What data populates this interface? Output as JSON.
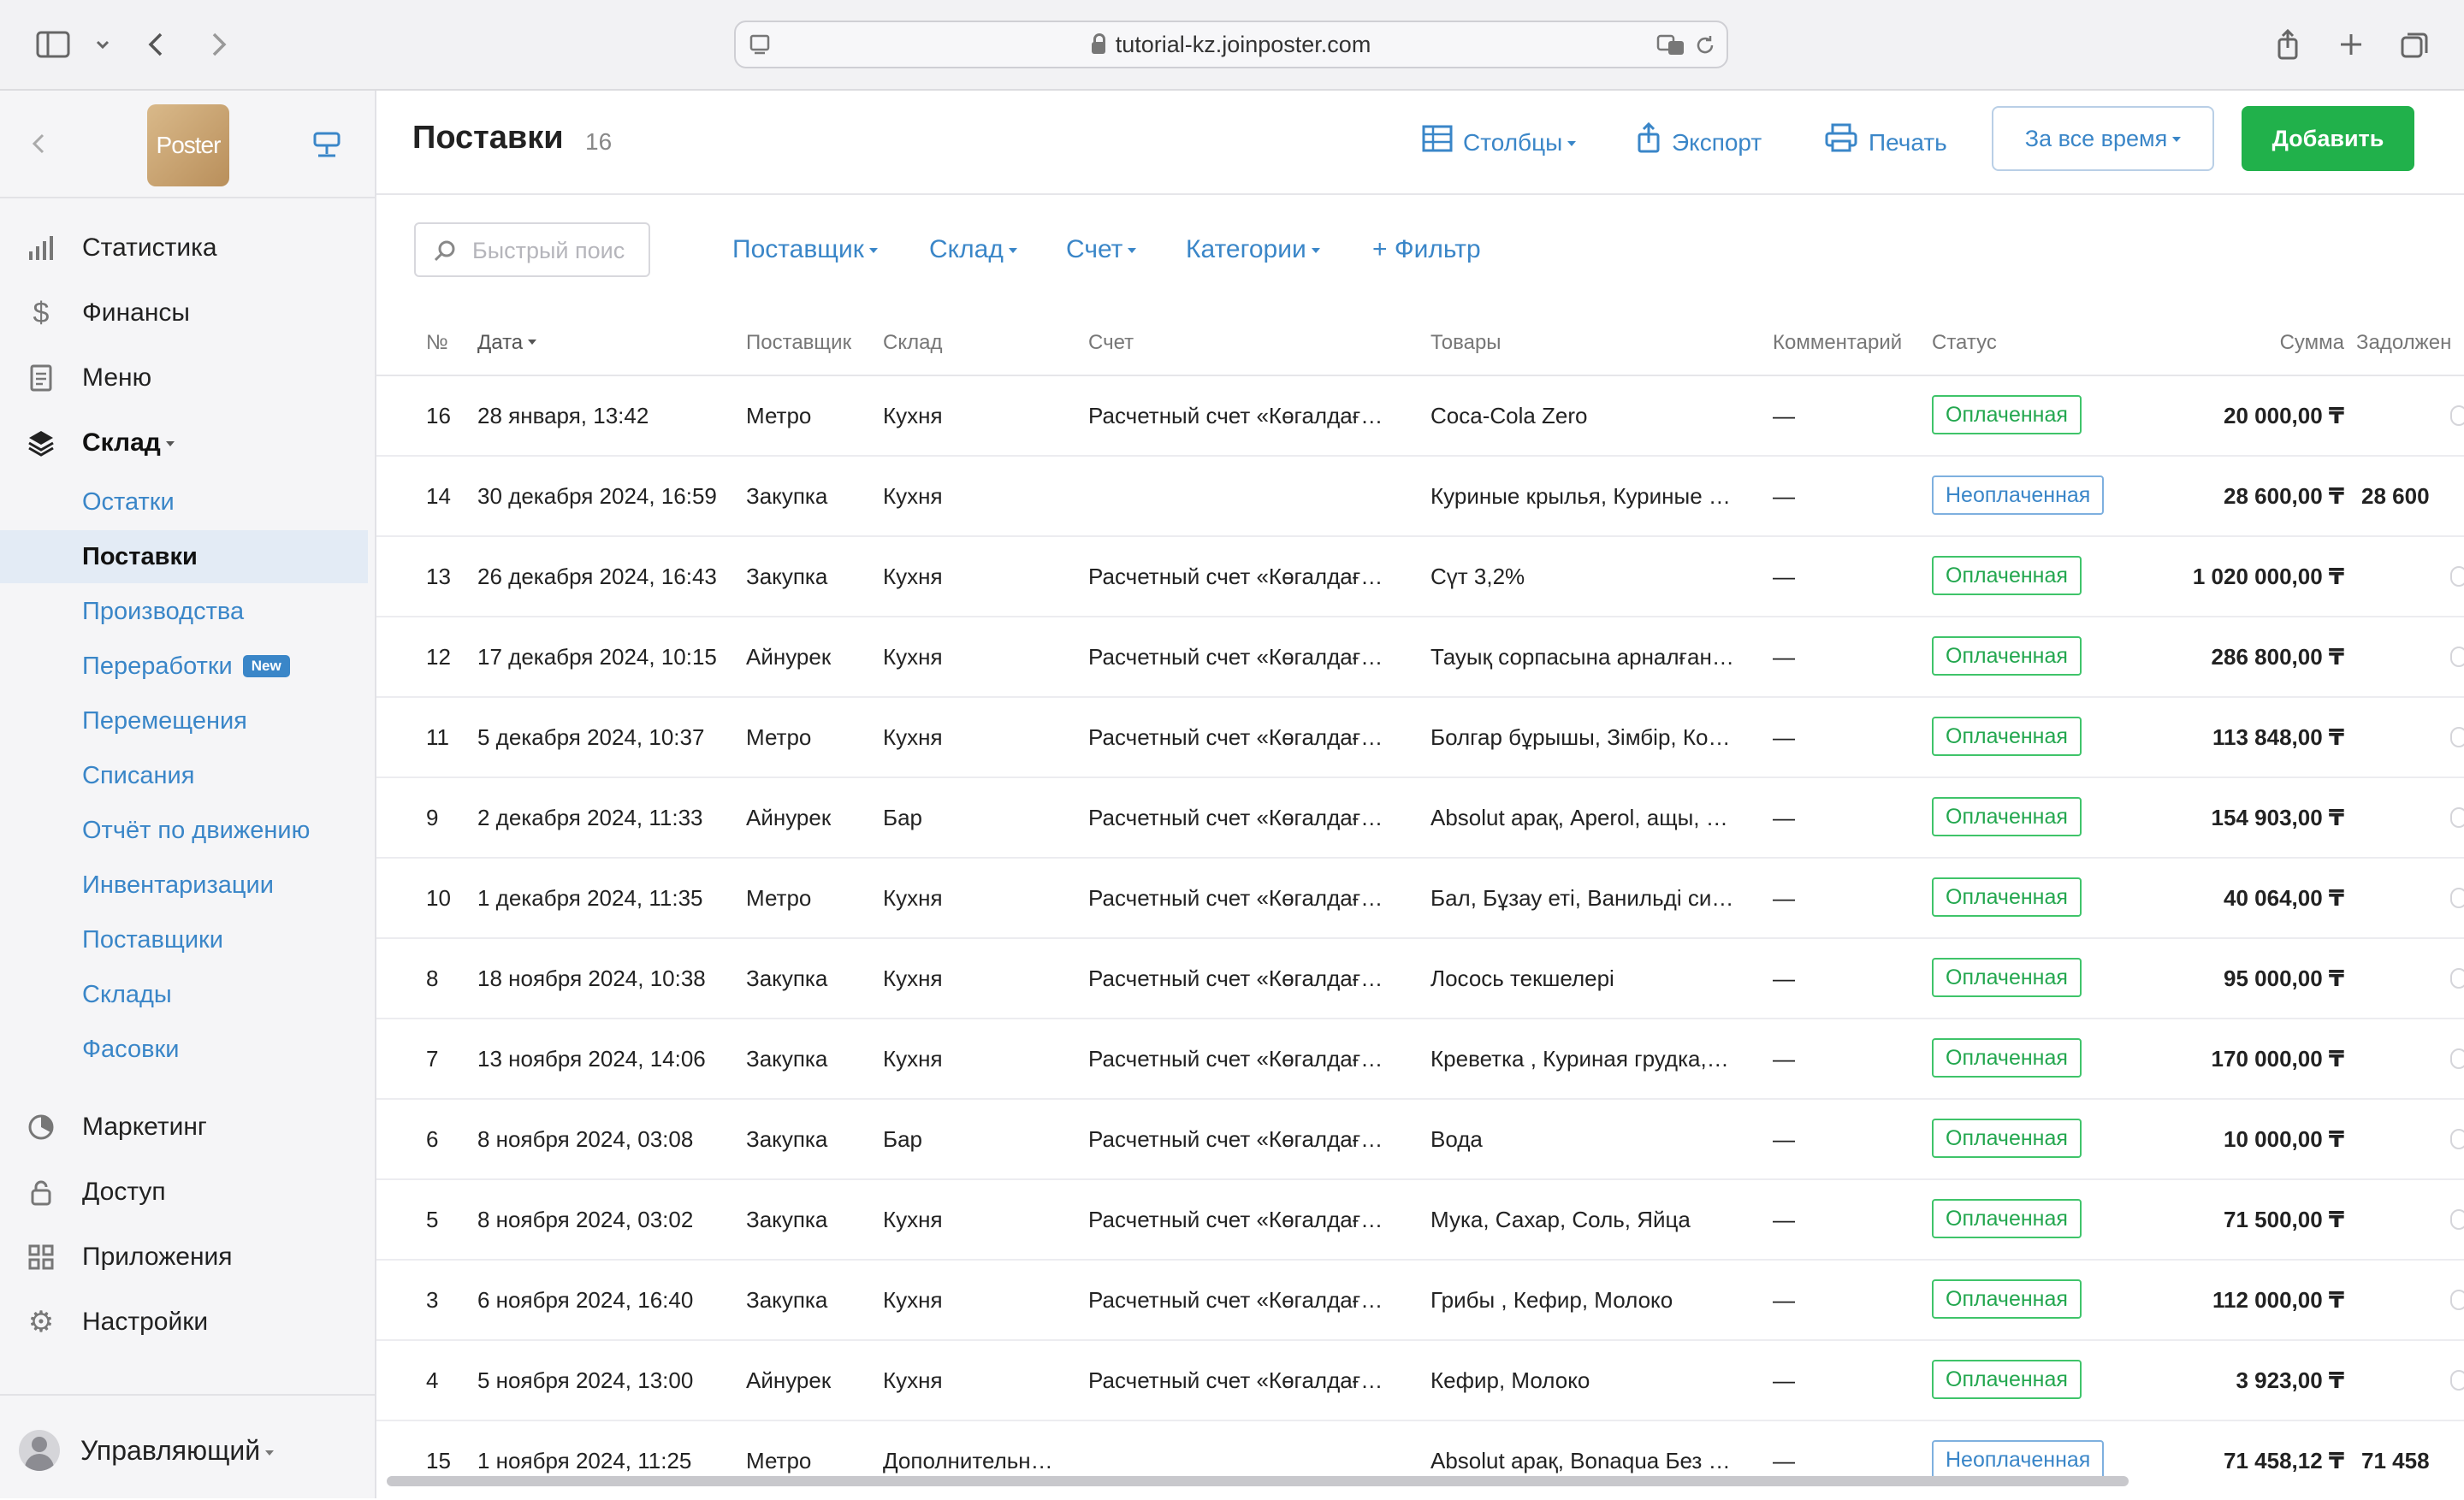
{
  "browser": {
    "url": "tutorial-kz.joinposter.com"
  },
  "sidebar": {
    "logo_text": "Poster",
    "nav_top": [
      {
        "label": "Статистика",
        "icon": "bar-chart-icon"
      },
      {
        "label": "Финансы",
        "icon": "dollar-icon"
      },
      {
        "label": "Меню",
        "icon": "document-icon"
      },
      {
        "label": "Склад",
        "icon": "layers-icon"
      }
    ],
    "sklad_sub": [
      {
        "label": "Остатки"
      },
      {
        "label": "Поставки"
      },
      {
        "label": "Производства"
      },
      {
        "label": "Переработки",
        "badge": "New"
      },
      {
        "label": "Перемещения"
      },
      {
        "label": "Списания"
      },
      {
        "label": "Отчёт по движению"
      },
      {
        "label": "Инвентаризации"
      },
      {
        "label": "Поставщики"
      },
      {
        "label": "Склады"
      },
      {
        "label": "Фасовки"
      }
    ],
    "nav_bottom": [
      {
        "label": "Маркетинг",
        "icon": "marketing-icon"
      },
      {
        "label": "Доступ",
        "icon": "lock-icon"
      },
      {
        "label": "Приложения",
        "icon": "apps-grid-icon"
      },
      {
        "label": "Настройки",
        "icon": "gear-icon"
      }
    ],
    "user": "Управляющий"
  },
  "header": {
    "title": "Поставки",
    "count": "16",
    "columns_btn": "Столбцы",
    "export_btn": "Экспорт",
    "print_btn": "Печать",
    "period_btn": "За все время",
    "add_btn": "Добавить"
  },
  "filters": {
    "search_placeholder": "Быстрый поис",
    "supplier": "Поставщик",
    "warehouse": "Склад",
    "account": "Счет",
    "categories": "Категории",
    "add_filter": "+ Фильтр"
  },
  "table": {
    "headers": {
      "num": "№",
      "date": "Дата",
      "supplier": "Поставщик",
      "warehouse": "Склад",
      "account": "Счет",
      "goods": "Товары",
      "comment": "Комментарий",
      "status": "Статус",
      "sum": "Сумма",
      "debt": "Задолжен"
    },
    "rows": [
      {
        "num": "16",
        "date": "28 января, 13:42",
        "supplier": "Метро",
        "warehouse": "Кухня",
        "account": "Расчетный счет «Көгалдағ…",
        "goods": "Coca-Cola Zero",
        "comment": "—",
        "status": "Оплаченная",
        "sum": "20 000,00 ₸",
        "debt": ""
      },
      {
        "num": "14",
        "date": "30 декабря 2024, 16:59",
        "supplier": "Закупка",
        "warehouse": "Кухня",
        "account": "",
        "goods": "Куриные крылья, Куриные …",
        "comment": "—",
        "status": "Неоплаченная",
        "sum": "28 600,00 ₸",
        "debt": "28 600"
      },
      {
        "num": "13",
        "date": "26 декабря 2024, 16:43",
        "supplier": "Закупка",
        "warehouse": "Кухня",
        "account": "Расчетный счет «Көгалдағ…",
        "goods": "Сүт 3,2%",
        "comment": "—",
        "status": "Оплаченная",
        "sum": "1 020 000,00 ₸",
        "debt": ""
      },
      {
        "num": "12",
        "date": "17 декабря 2024, 10:15",
        "supplier": "Айнурек",
        "warehouse": "Кухня",
        "account": "Расчетный счет «Көгалдағ…",
        "goods": "Тауық сорпасына арналған…",
        "comment": "—",
        "status": "Оплаченная",
        "sum": "286 800,00 ₸",
        "debt": ""
      },
      {
        "num": "11",
        "date": "5 декабря 2024, 10:37",
        "supplier": "Метро",
        "warehouse": "Кухня",
        "account": "Расчетный счет «Көгалдағ…",
        "goods": "Болгар бұрышы, Зімбір, Ко…",
        "comment": "—",
        "status": "Оплаченная",
        "sum": "113 848,00 ₸",
        "debt": ""
      },
      {
        "num": "9",
        "date": "2 декабря 2024, 11:33",
        "supplier": "Айнурек",
        "warehouse": "Бар",
        "account": "Расчетный счет «Көгалдағ…",
        "goods": "Absolut арақ, Aperol, ащы, …",
        "comment": "—",
        "status": "Оплаченная",
        "sum": "154 903,00 ₸",
        "debt": ""
      },
      {
        "num": "10",
        "date": "1 декабря 2024, 11:35",
        "supplier": "Метро",
        "warehouse": "Кухня",
        "account": "Расчетный счет «Көгалдағ…",
        "goods": "Бал, Бұзау еті, Ванильді си…",
        "comment": "—",
        "status": "Оплаченная",
        "sum": "40 064,00 ₸",
        "debt": ""
      },
      {
        "num": "8",
        "date": "18 ноября 2024, 10:38",
        "supplier": "Закупка",
        "warehouse": "Кухня",
        "account": "Расчетный счет «Көгалдағ…",
        "goods": "Лосось текшелері",
        "comment": "—",
        "status": "Оплаченная",
        "sum": "95 000,00 ₸",
        "debt": ""
      },
      {
        "num": "7",
        "date": "13 ноября 2024, 14:06",
        "supplier": "Закупка",
        "warehouse": "Кухня",
        "account": "Расчетный счет «Көгалдағ…",
        "goods": "Креветка , Куриная грудка,…",
        "comment": "—",
        "status": "Оплаченная",
        "sum": "170 000,00 ₸",
        "debt": ""
      },
      {
        "num": "6",
        "date": "8 ноября 2024, 03:08",
        "supplier": "Закупка",
        "warehouse": "Бар",
        "account": "Расчетный счет «Көгалдағ…",
        "goods": "Вода",
        "comment": "—",
        "status": "Оплаченная",
        "sum": "10 000,00 ₸",
        "debt": ""
      },
      {
        "num": "5",
        "date": "8 ноября 2024, 03:02",
        "supplier": "Закупка",
        "warehouse": "Кухня",
        "account": "Расчетный счет «Көгалдағ…",
        "goods": "Мука, Сахар, Соль, Яйца",
        "comment": "—",
        "status": "Оплаченная",
        "sum": "71 500,00 ₸",
        "debt": ""
      },
      {
        "num": "3",
        "date": "6 ноября 2024, 16:40",
        "supplier": "Закупка",
        "warehouse": "Кухня",
        "account": "Расчетный счет «Көгалдағ…",
        "goods": "Грибы , Кефир, Молоко",
        "comment": "—",
        "status": "Оплаченная",
        "sum": "112 000,00 ₸",
        "debt": ""
      },
      {
        "num": "4",
        "date": "5 ноября 2024, 13:00",
        "supplier": "Айнурек",
        "warehouse": "Кухня",
        "account": "Расчетный счет «Көгалдағ…",
        "goods": "Кефир, Молоко",
        "comment": "—",
        "status": "Оплаченная",
        "sum": "3 923,00 ₸",
        "debt": ""
      },
      {
        "num": "15",
        "date": "1 ноября 2024, 11:25",
        "supplier": "Метро",
        "warehouse": "Дополнительн…",
        "account": "",
        "goods": "Absolut арақ, Bonaqua Без …",
        "comment": "—",
        "status": "Неоплаченная",
        "sum": "71 458,12 ₸",
        "debt": "71 458"
      }
    ]
  },
  "colors": {
    "accent": "#3a86c8",
    "paid": "#23a74f",
    "add_button": "#21b14b"
  }
}
